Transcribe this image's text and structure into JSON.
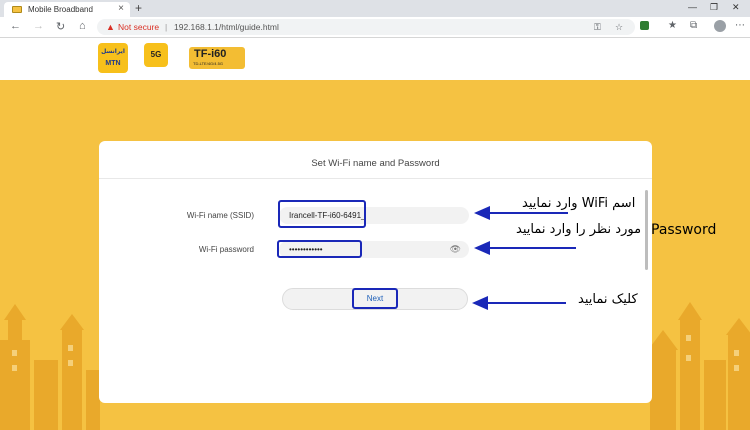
{
  "browser": {
    "tab_title": "Mobile Broadband",
    "tab_close": "×",
    "new_tab": "+",
    "security_label": "Not secure",
    "url_separator": "|",
    "url": "192.168.1.1/html/guide.html"
  },
  "page": {
    "mtn_text_top": "ایرانسل",
    "mtn_text_bottom": "MTN",
    "logo_5g": "5G",
    "tf_logo": "TF-i60",
    "tf_sub": "TD-LTE/4G/4.5G"
  },
  "form": {
    "title": "Set Wi-Fi name and Password",
    "ssid_label": "Wi-Fi name (SSID)",
    "ssid_value": "Irancell-TF-i60-6491_",
    "password_label": "Wi-Fi password",
    "password_value": "••••••••••••",
    "next_label": "Next"
  },
  "annotations": {
    "wifi_note": "اسم WiFi وارد نمایید",
    "password_note_en": "Password",
    "password_note_fa": "مورد نظر را وارد نمایید",
    "next_note": "کلیک نمایید",
    "color": "#1a28b8"
  }
}
